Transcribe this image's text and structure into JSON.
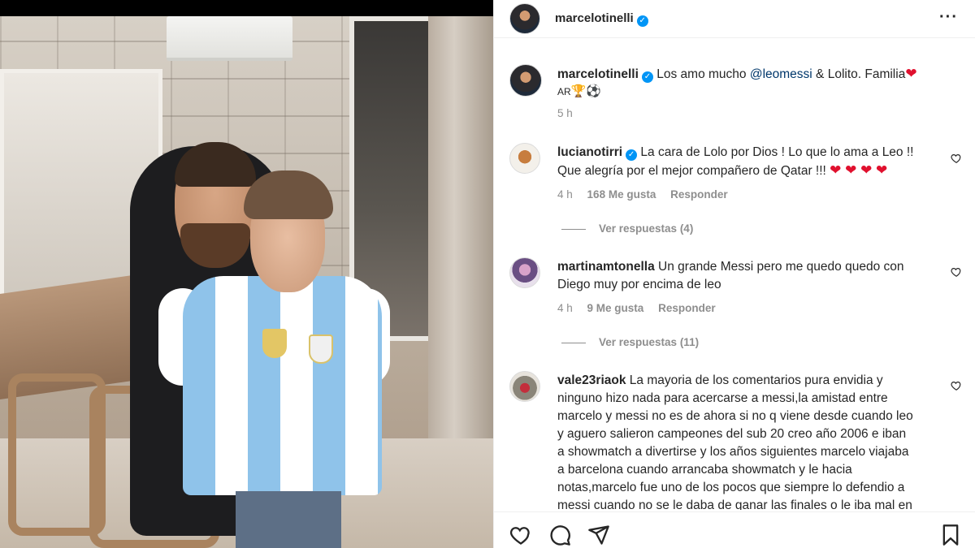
{
  "post": {
    "author": "marcelotinelli",
    "verified": true,
    "caption_pre": "Los amo mucho ",
    "caption_mention": "@leomessi",
    "caption_post": " & Lolito. Familia",
    "caption_line2": "AR",
    "time": "5 h"
  },
  "comments": [
    {
      "user": "lucianotirri",
      "verified": true,
      "line1": "La cara de Lolo por Dios ! Lo que lo ama a Leo !!",
      "line2": "Que alegría por el mejor compañero de Qatar !!!",
      "time": "4 h",
      "likes": "168 Me gusta",
      "reply": "Responder",
      "view_replies": "Ver respuestas (4)"
    },
    {
      "user": "martinamtonella",
      "verified": false,
      "line1": "Un grande Messi pero me quedo quedo con",
      "line2": "Diego muy por encima de leo",
      "time": "4 h",
      "likes": "9 Me gusta",
      "reply": "Responder",
      "view_replies": "Ver respuestas (11)"
    },
    {
      "user": "vale23riaok",
      "verified": false,
      "lines": [
        "La mayoria de los comentarios pura envidia y",
        "ninguno hizo nada para acercarse a messi,la amistad entre",
        "marcelo y messi no es de ahora si no q viene desde cuando leo",
        "y aguero salieron campeones del sub 20 creo año 2006 e iban",
        "a showmatch a divertirse y los años siguientes marcelo viajaba",
        "a barcelona cuando arrancaba showmatch y le hacia",
        "notas,marcelo fue uno de los pocos que siempre lo defendio a",
        "messi cuando no se le daba de ganar las finales o le iba mal en"
      ]
    }
  ],
  "icons": {
    "more": "more-options-icon",
    "like": "heart-icon",
    "comment": "comment-icon",
    "share": "share-icon",
    "save": "bookmark-icon"
  },
  "colors": {
    "verified": "#0095f6",
    "mention": "#00376b",
    "muted": "#8e8e8e",
    "heart": "#e0102e"
  }
}
